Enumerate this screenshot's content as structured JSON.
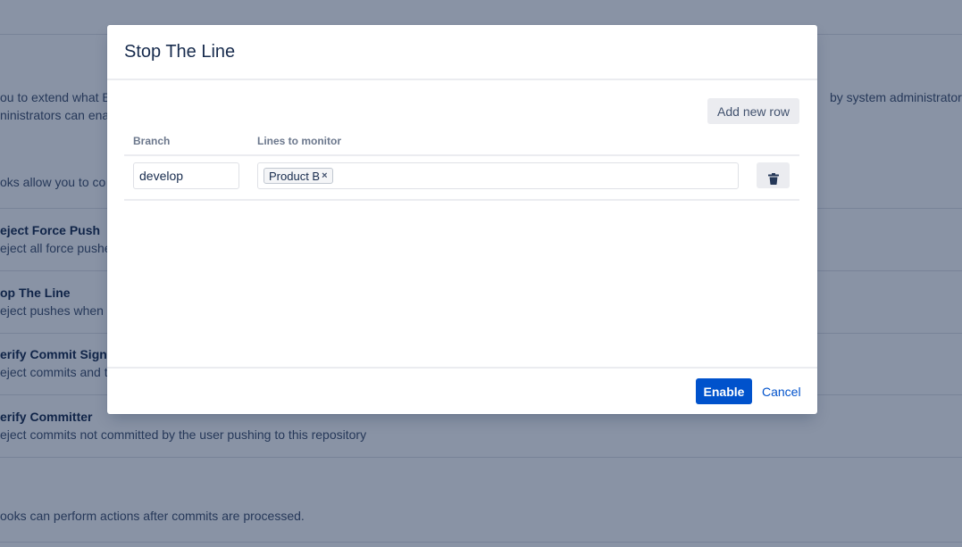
{
  "background": {
    "intro_line_1_left": "ou to extend what B",
    "intro_line_1_right": "by system administrators a",
    "intro_line_2": "ninistrators can enal",
    "pre_receive_intro": "oks allow you to co",
    "hooks": [
      {
        "title": "eject Force Push",
        "description": "eject all force pushe"
      },
      {
        "title": "op The Line",
        "description": "eject pushes when c"
      },
      {
        "title": "erify Commit Signat",
        "description": "eject commits and t"
      },
      {
        "title": "erify Committer",
        "description": "eject commits not committed by the user pushing to this repository"
      }
    ],
    "post_receive_intro": "ooks can perform actions after commits are processed."
  },
  "dialog": {
    "title": "Stop The Line",
    "add_row_label": "Add new row",
    "columns": {
      "branch": "Branch",
      "lines": "Lines to monitor"
    },
    "rows": [
      {
        "branch": "develop",
        "lines": [
          {
            "label": "Product B",
            "remove": "×"
          }
        ]
      }
    ],
    "footer": {
      "enable_label": "Enable",
      "cancel_label": "Cancel"
    }
  },
  "colors": {
    "primary": "#0052cc",
    "overlay": "#091e42",
    "text": "#172b4d"
  },
  "icons": {
    "delete": "trash-icon"
  }
}
